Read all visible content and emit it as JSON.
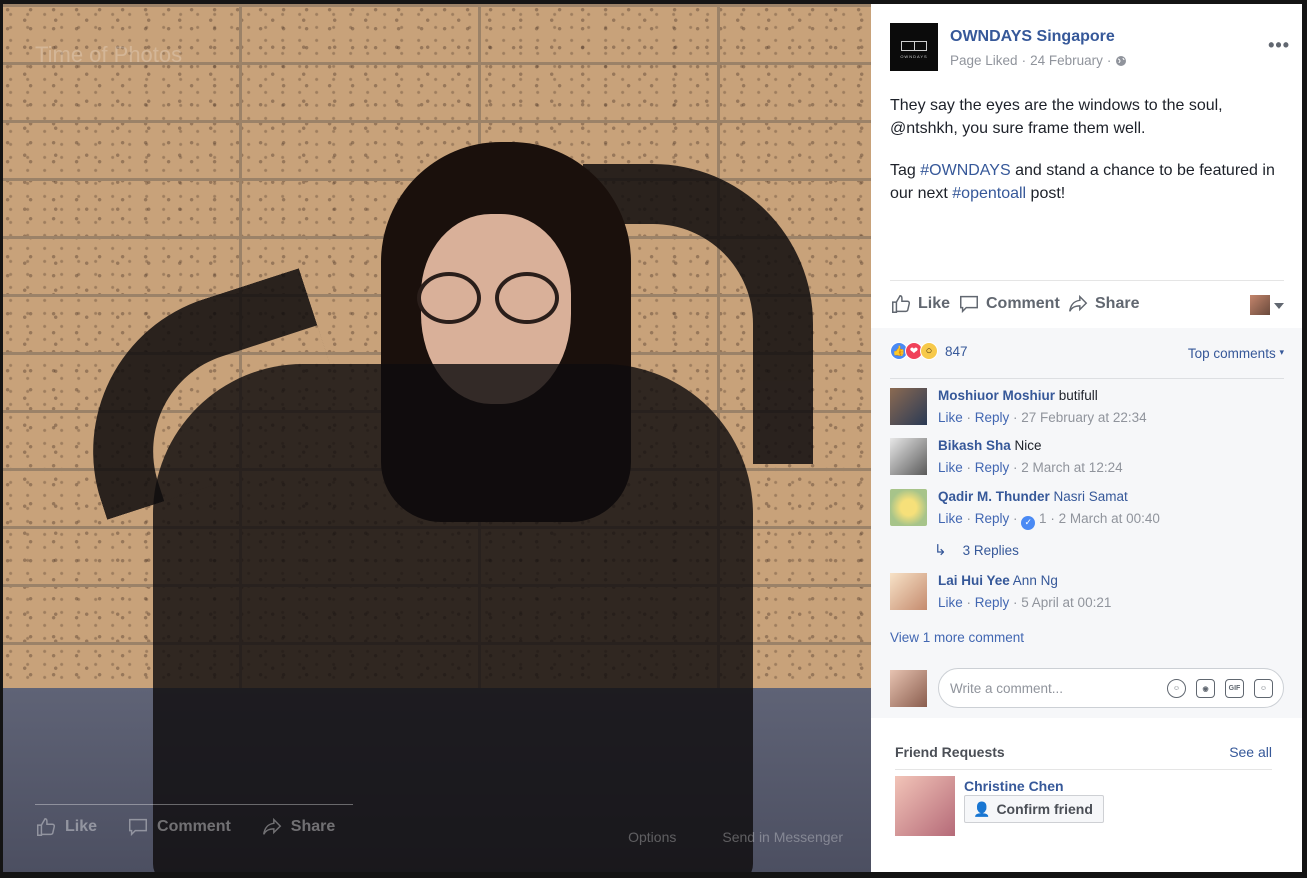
{
  "photo": {
    "watermark": "Time of Photos",
    "overlay_actions": [
      {
        "label": "Like",
        "icon": "thumbs-up-icon"
      },
      {
        "label": "Comment",
        "icon": "comment-icon"
      },
      {
        "label": "Share",
        "icon": "share-icon"
      }
    ],
    "overlay_options": "Options",
    "overlay_messenger": "Send in Messenger"
  },
  "post": {
    "page_name": "OWNDAYS Singapore",
    "logo_word": "OWNDAYS",
    "page_liked": "Page Liked",
    "date": "24 February",
    "separator": "·",
    "more_label": "•••",
    "text_line1": "They say the eyes are the windows to the soul, @ntshkh, you sure frame them well.",
    "text_tag_prefix": "Tag ",
    "hashtag1": "#OWNDAYS",
    "text_mid": " and stand a chance to be featured in our next ",
    "hashtag2": "#opentoall",
    "text_suffix": " post!"
  },
  "actions": {
    "like": "Like",
    "comment": "Comment",
    "share": "Share"
  },
  "reactions": {
    "count": "847",
    "sort_label": "Top comments"
  },
  "comments": [
    {
      "author": "Moshiuor Moshiur",
      "text": " butifull",
      "mention": "",
      "like": "Like",
      "reply": "Reply",
      "likes": "",
      "time": "27 February at 22:34"
    },
    {
      "author": "Bikash Sha",
      "text": " Nice",
      "mention": "",
      "like": "Like",
      "reply": "Reply",
      "likes": "",
      "time": "2 March at 12:24"
    },
    {
      "author": "Qadir M. Thunder",
      "text": "",
      "mention": " Nasri Samat",
      "like": "Like",
      "reply": "Reply",
      "likes": "1",
      "time": "2 March at 00:40"
    },
    {
      "author": "Lai Hui Yee",
      "text": "",
      "mention": " Ann Ng",
      "like": "Like",
      "reply": "Reply",
      "likes": "",
      "time": "5 April at 00:21"
    }
  ],
  "replies_label": "3 Replies",
  "view_more": "View 1 more comment",
  "write_placeholder": "Write a comment...",
  "write_icons": {
    "emoji": "emoji-icon",
    "camera": "camera-icon",
    "gif": "GIF",
    "sticker": "sticker-icon"
  },
  "friend_requests": {
    "title": "Friend Requests",
    "see_all": "See all",
    "name": "Christine Chen",
    "confirm": "Confirm friend"
  },
  "colors": {
    "link": "#365899",
    "muted": "#90949c",
    "text": "#1d2129",
    "panel_bg": "#f6f7f9"
  }
}
